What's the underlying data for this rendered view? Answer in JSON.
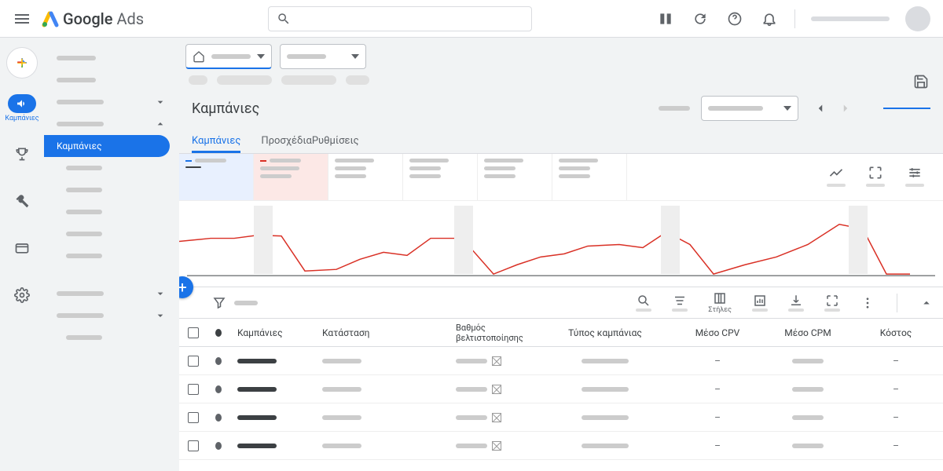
{
  "header": {
    "brand_google": "Google",
    "brand_ads": "Ads"
  },
  "rail": {
    "campaigns_label": "Καμπάνιες"
  },
  "sidepanel": {
    "selected_label": "Καμπάνιες"
  },
  "selectors": {},
  "page": {
    "title": "Καμπάνιες"
  },
  "tabs": {
    "campaigns": "Καμπάνιες",
    "drafts": "Προσχέδια",
    "settings": "Ρυθμίσεις"
  },
  "table": {
    "toolbar": {
      "columns_label": "Στήλες"
    },
    "headers": {
      "campaigns": "Καμπάνιες",
      "status": "Κατάσταση",
      "opt_score": "Βαθμός βελτιστοποίησης",
      "type": "Τύπος καμπάνιας",
      "avg_cpv": "Μέσο CPV",
      "avg_cpm": "Μέσο CPM",
      "cost": "Κόστος"
    },
    "rows": [
      {
        "cpv": "–",
        "cpm_has_value": true
      },
      {
        "cpv": "–",
        "cpm_has_value": true
      },
      {
        "cpv": "–",
        "cpm_has_value": true
      },
      {
        "cpv": "–",
        "cpm_has_value": true
      }
    ]
  },
  "chart_data": {
    "type": "line",
    "title": "",
    "xlabel": "",
    "ylabel": "",
    "series": [
      {
        "name": "metric-red",
        "color": "#d93025",
        "points": [
          [
            0,
            52
          ],
          [
            40,
            48
          ],
          [
            70,
            48
          ],
          [
            100,
            44
          ],
          [
            130,
            45
          ],
          [
            160,
            90
          ],
          [
            200,
            88
          ],
          [
            230,
            75
          ],
          [
            260,
            66
          ],
          [
            290,
            70
          ],
          [
            320,
            48
          ],
          [
            360,
            48
          ],
          [
            400,
            94
          ],
          [
            430,
            82
          ],
          [
            460,
            72
          ],
          [
            490,
            68
          ],
          [
            520,
            58
          ],
          [
            560,
            56
          ],
          [
            590,
            60
          ],
          [
            620,
            40
          ],
          [
            650,
            56
          ],
          [
            680,
            94
          ],
          [
            720,
            82
          ],
          [
            760,
            72
          ],
          [
            800,
            56
          ],
          [
            840,
            30
          ],
          [
            870,
            36
          ],
          [
            900,
            94
          ],
          [
            930,
            94
          ]
        ]
      }
    ],
    "baseline_y": 96,
    "bands_x": [
      95,
      350,
      613,
      852
    ],
    "band_width": 24
  },
  "colors": {
    "primary": "#1a73e8",
    "danger": "#d93025",
    "text": "#3c4043",
    "muted": "#5f6368"
  }
}
